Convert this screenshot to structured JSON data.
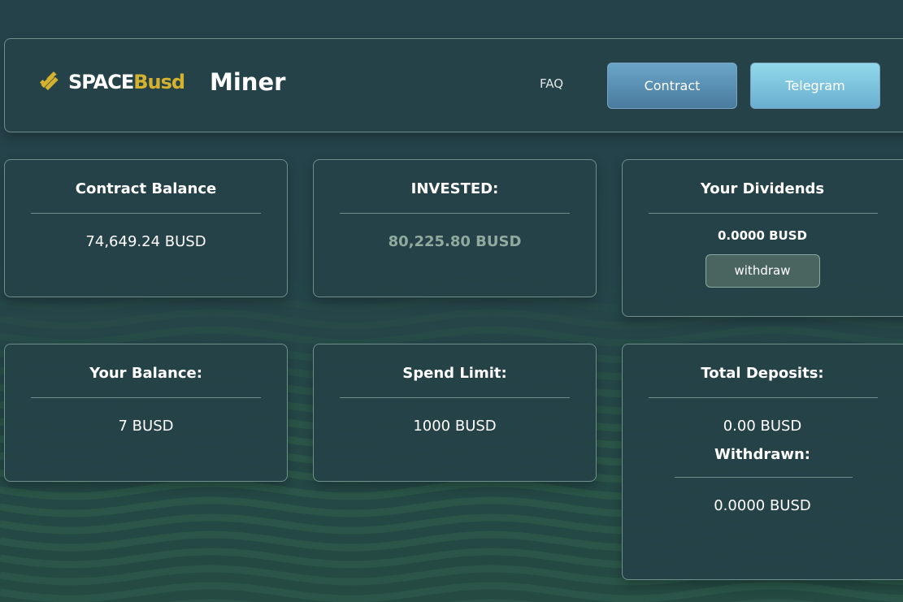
{
  "header": {
    "logo": {
      "part1": "SPACE",
      "part2": "Busd"
    },
    "title": "Miner",
    "nav": {
      "faq": "FAQ",
      "contract": "Contract",
      "telegram": "Telegram"
    }
  },
  "colors": {
    "brand_yellow": "#d4b22f",
    "contract_button": "#5a90b5",
    "telegram_button": "#82c8e0"
  },
  "cards": {
    "contract_balance": {
      "label": "Contract Balance",
      "value": "74,649.24 BUSD"
    },
    "invested": {
      "label": "INVESTED:",
      "value": "80,225.80 BUSD"
    },
    "dividends": {
      "label": "Your Dividends",
      "value": "0.0000 BUSD",
      "button": "withdraw"
    },
    "your_balance": {
      "label": "Your Balance:",
      "value": "7 BUSD"
    },
    "spend_limit": {
      "label": "Spend Limit:",
      "value": "1000 BUSD"
    },
    "total_deposits": {
      "label": "Total Deposits:",
      "value": "0.00 BUSD",
      "withdrawn_label": "Withdrawn:",
      "withdrawn_value": "0.0000 BUSD"
    }
  }
}
